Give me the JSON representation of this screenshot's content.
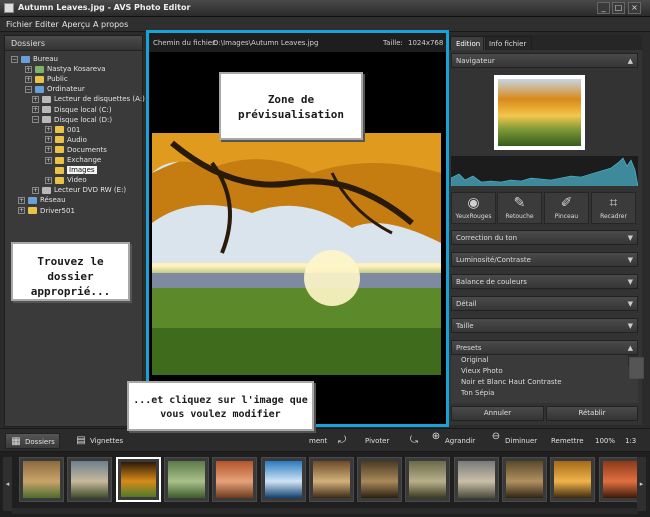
{
  "window": {
    "title": "Autumn Leaves.jpg - AVS Photo Editor",
    "controls": [
      "_",
      "□",
      "×"
    ]
  },
  "menu": [
    "Fichier",
    "Editer",
    "Aperçu",
    "A propos"
  ],
  "left_panel": {
    "header": "Dossiers",
    "tree": [
      {
        "label": "Bureau",
        "icon": "desktop-icon",
        "expander": "−"
      },
      {
        "label": "Nastya Kosareva",
        "icon": "user-folder-icon",
        "expander": "+"
      },
      {
        "label": "Public",
        "icon": "folder-icon",
        "expander": "+"
      },
      {
        "label": "Ordinateur",
        "icon": "computer-icon",
        "expander": "−"
      },
      {
        "label": "Lecteur de disquettes (A:)",
        "icon": "floppy-icon",
        "expander": "+"
      },
      {
        "label": "Disque local (C:)",
        "icon": "drive-icon",
        "expander": "+"
      },
      {
        "label": "Disque local (D:)",
        "icon": "drive-icon",
        "expander": "−"
      },
      {
        "label": "001",
        "icon": "folder-icon",
        "expander": "+"
      },
      {
        "label": "Audio",
        "icon": "folder-icon",
        "expander": "+"
      },
      {
        "label": "Documents",
        "icon": "folder-icon",
        "expander": "+"
      },
      {
        "label": "Exchange",
        "icon": "folder-icon",
        "expander": "+"
      },
      {
        "label": "Images",
        "icon": "folder-icon",
        "expander": "",
        "selected": true
      },
      {
        "label": "Video",
        "icon": "folder-icon",
        "expander": "+"
      },
      {
        "label": "Lecteur DVD RW (E:)",
        "icon": "dvd-icon",
        "expander": "+"
      },
      {
        "label": "Réseau",
        "icon": "network-icon",
        "expander": "+"
      },
      {
        "label": "Driver501",
        "icon": "folder-icon",
        "expander": "+"
      }
    ]
  },
  "preview": {
    "path_label": "Chemin du fichier:",
    "path_value": "D:\\Images\\Autumn Leaves.jpg",
    "size_label": "Taille:",
    "size_value": "1024x768"
  },
  "right_panel": {
    "tabs": [
      "Edition",
      "Info fichier"
    ],
    "navigator_label": "Navigateur",
    "tools": [
      {
        "label": "YeuxRouges",
        "icon": "eye-icon"
      },
      {
        "label": "Retouche",
        "icon": "retouch-brush-icon"
      },
      {
        "label": "Pinceau",
        "icon": "paintbrush-icon"
      },
      {
        "label": "Recadrer",
        "icon": "crop-icon"
      }
    ],
    "sections": [
      "Correction du ton",
      "Luminosité/Contraste",
      "Balance de couleurs",
      "Détail",
      "Taille",
      "Presets"
    ],
    "presets": [
      "Original",
      "Vieux Photo",
      "Noir et Blanc Haut Contraste",
      "Ton Sépia"
    ],
    "undo_label": "Annuler",
    "reset_label": "Rétablir"
  },
  "toolbar": {
    "dossiers": "Dossiers",
    "vignettes": "Vignettes",
    "ment": "ment",
    "pivoter": "Pivoter",
    "agrandir": "Agrandir",
    "diminuer": "Diminuer",
    "remettre": "Remettre",
    "zoom": "100%",
    "ratio": "1:3"
  },
  "callouts": {
    "zone": "Zone de prévisualisation",
    "dossier": "Trouvez le dossier approprié...",
    "click": "...et cliquez sur l'image que vous voulez modifier"
  },
  "thumbnails": [
    {
      "colors": [
        "#8b6a3e",
        "#c9a46b",
        "#4e6b2e"
      ]
    },
    {
      "colors": [
        "#6d7f8f",
        "#c7b99c",
        "#3a4a2a"
      ]
    },
    {
      "colors": [
        "#2d1a08",
        "#d68b1a",
        "#4f7a2a"
      ],
      "selected": true
    },
    {
      "colors": [
        "#5b7a4a",
        "#a9c08a",
        "#3d5a2d"
      ]
    },
    {
      "colors": [
        "#b3542a",
        "#e7a27a",
        "#6b3a1e"
      ]
    },
    {
      "colors": [
        "#2a7ac0",
        "#cfe4f5",
        "#0f3f6b"
      ]
    },
    {
      "colors": [
        "#6b4a2a",
        "#d1b07a",
        "#3d2a16"
      ]
    },
    {
      "colors": [
        "#4a3a22",
        "#a8895a",
        "#2a1f10"
      ]
    },
    {
      "colors": [
        "#6a6a4a",
        "#b8b08a",
        "#3a3a22"
      ]
    },
    {
      "colors": [
        "#7a7a7a",
        "#c9c0a8",
        "#4a4a3a"
      ]
    },
    {
      "colors": [
        "#5a4a2a",
        "#b09060",
        "#2f2414"
      ]
    },
    {
      "colors": [
        "#a56a1a",
        "#f0b34a",
        "#3b2a10"
      ]
    },
    {
      "colors": [
        "#8a3a1a",
        "#e07040",
        "#3a1a0a"
      ]
    }
  ]
}
